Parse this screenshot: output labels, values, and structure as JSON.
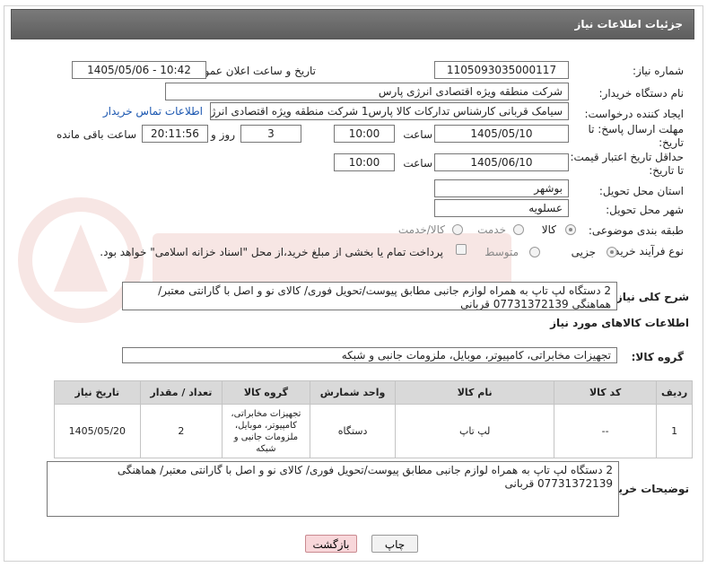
{
  "header": {
    "title": "جزئیات اطلاعات نیاز"
  },
  "fields": {
    "need_number": {
      "label": "شماره نیاز:",
      "value": "1105093035000117"
    },
    "announce": {
      "label": "تاریخ و ساعت اعلان عمومی:",
      "value": "1405/05/06 - 10:42"
    },
    "buyer_org": {
      "label": "نام دستگاه خریدار:",
      "value": "شرکت منطقه ویژه اقتصادی انرژی پارس"
    },
    "requester": {
      "label": "ایجاد کننده درخواست:",
      "value": "سیامک قربانی کارشناس تدارکات کالا پارس1 شرکت منطقه ویژه اقتصادی انرژی",
      "contact_link": "اطلاعات تماس خریدار"
    },
    "send_deadline": {
      "label_line1": "مهلت ارسال پاسخ: تا",
      "label_line2": "تاریخ:",
      "date": "1405/05/10",
      "time_label": "ساعت",
      "time": "10:00",
      "days": "3",
      "days_label": "روز و",
      "remaining": "20:11:56",
      "remaining_label": "ساعت باقی مانده"
    },
    "price_deadline": {
      "label_line1": "حداقل تاریخ اعتبار قیمت:",
      "label_line2": "تا تاریخ:",
      "date": "1405/06/10",
      "time_label": "ساعت",
      "time": "10:00"
    },
    "province": {
      "label": "استان محل تحویل:",
      "value": "بوشهر"
    },
    "city": {
      "label": "شهر محل تحویل:",
      "value": "عسلویه"
    },
    "category": {
      "label": "طبقه بندی موضوعی:",
      "options": [
        "کالا",
        "خدمت",
        "کالا/خدمت"
      ]
    },
    "purchase_type": {
      "label": "نوع فرآیند خرید :",
      "options": [
        "جزیی",
        "متوسط"
      ],
      "payment_note": "پرداخت تمام یا بخشی از مبلغ خرید،از محل \"اسناد خزانه اسلامی\" خواهد بود."
    }
  },
  "description": {
    "label": "شرح کلی نیاز:",
    "text": "2 دستگاه لپ تاپ به همراه لوازم جانبی مطابق پیوست/تحویل فوری/ کالای نو و اصل با گارانتی معتبر/ هماهنگی 07731372139 قربانی"
  },
  "items_section": {
    "title": "اطلاعات کالاهای مورد نیاز",
    "group_label": "گروه کالا:",
    "group_value": "تجهیزات مخابراتی، کامپیوتر، موبایل، ملزومات جانبی و شبکه",
    "columns": [
      "ردیف",
      "کد کالا",
      "نام کالا",
      "واحد شمارش",
      "گروه کالا",
      "تعداد / مقدار",
      "تاریخ نیاز"
    ],
    "rows": [
      [
        "1",
        "--",
        "لپ تاپ",
        "دستگاه",
        "تجهیزات مخابراتی، کامپیوتر، موبایل، ملزومات جانبی و شبکه",
        "2",
        "1405/05/20"
      ]
    ]
  },
  "buyer_notes": {
    "label": "توضیحات خریدار:",
    "text": "2 دستگاه لپ تاپ به همراه لوازم جانبی مطابق پیوست/تحویل فوری/ کالای نو و اصل با گارانتی معتبر/ هماهنگی 07731372139 قربانی"
  },
  "buttons": {
    "print": "چاپ",
    "back": "بازگشت"
  },
  "colors": {
    "header": "#6b6b6b",
    "link": "#1a56b0",
    "back_button": "#f8d7da"
  }
}
